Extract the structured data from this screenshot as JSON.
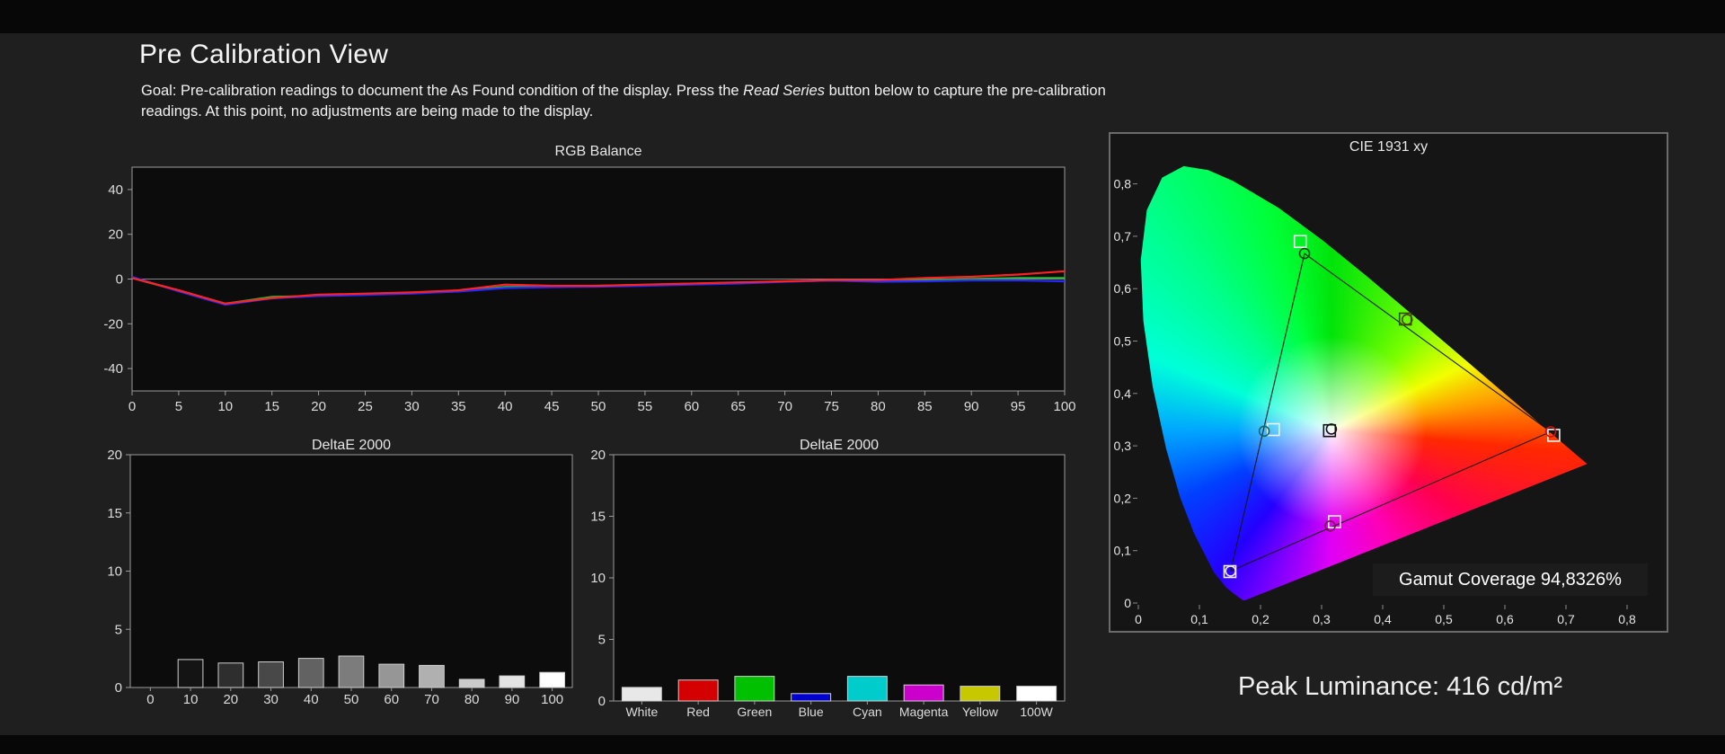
{
  "page": {
    "title": "Pre Calibration View",
    "goal": {
      "part1": "Goal: Pre-calibration readings to document the As Found condition of the display. Press the ",
      "italic": "Read Series",
      "part2": " button below to capture the pre-calibration readings. At this point, no adjustments are being made to the display."
    },
    "peak_luminance": "Peak Luminance: 416 cd/m²"
  },
  "chart_data": [
    {
      "id": "rgb_balance",
      "type": "line",
      "title": "RGB Balance",
      "xlabel": "",
      "ylabel": "",
      "ylim": [
        -50,
        50
      ],
      "y_ticks": [
        -40,
        -20,
        0,
        20,
        40
      ],
      "x_ticks": [
        0,
        5,
        10,
        15,
        20,
        25,
        30,
        35,
        40,
        45,
        50,
        55,
        60,
        65,
        70,
        75,
        80,
        85,
        90,
        95,
        100
      ],
      "x": [
        0,
        5,
        10,
        15,
        20,
        25,
        30,
        35,
        40,
        45,
        50,
        55,
        60,
        65,
        70,
        75,
        80,
        85,
        90,
        95,
        100
      ],
      "series": [
        {
          "name": "green",
          "color": "#2db82d",
          "values": [
            0.5,
            -5.2,
            -11.0,
            -8.0,
            -7.5,
            -7.0,
            -6.2,
            -5.5,
            -3.5,
            -3.5,
            -3.0,
            -2.6,
            -2.1,
            -1.6,
            -1.1,
            -0.6,
            -1.0,
            -0.5,
            0.0,
            0.5,
            0.5
          ]
        },
        {
          "name": "blue",
          "color": "#2828ff",
          "values": [
            1.0,
            -5.5,
            -11.5,
            -8.6,
            -7.6,
            -7.1,
            -6.5,
            -5.6,
            -4.0,
            -3.6,
            -3.4,
            -3.0,
            -2.5,
            -2.0,
            -1.2,
            -0.7,
            -1.2,
            -1.0,
            -0.6,
            -0.6,
            -1.0
          ]
        },
        {
          "name": "red",
          "color": "#ff2222",
          "values": [
            0.5,
            -5.0,
            -11.0,
            -8.5,
            -7.0,
            -6.5,
            -6.0,
            -5.0,
            -2.5,
            -3.0,
            -3.0,
            -2.5,
            -2.0,
            -1.5,
            -1.0,
            -0.5,
            -0.5,
            0.5,
            1.0,
            2.0,
            3.5
          ]
        }
      ]
    },
    {
      "id": "deltae_grayscale",
      "type": "bar",
      "title": "DeltaE 2000",
      "ylim": [
        0,
        20
      ],
      "y_ticks": [
        0,
        5,
        10,
        15,
        20
      ],
      "categories": [
        "0",
        "10",
        "20",
        "30",
        "40",
        "50",
        "60",
        "70",
        "80",
        "90",
        "100"
      ],
      "values": [
        0,
        2.4,
        2.1,
        2.2,
        2.5,
        2.7,
        2.0,
        1.9,
        0.7,
        1.0,
        1.3
      ],
      "bar_colors": [
        "#000000",
        "#141414",
        "#2e2e2e",
        "#484848",
        "#626262",
        "#7c7c7c",
        "#969696",
        "#b0b0b0",
        "#cacaca",
        "#e4e4e4",
        "#ffffff"
      ]
    },
    {
      "id": "deltae_colors",
      "type": "bar",
      "title": "DeltaE 2000",
      "ylim": [
        0,
        20
      ],
      "y_ticks": [
        0,
        5,
        10,
        15,
        20
      ],
      "categories": [
        "White",
        "Red",
        "Green",
        "Blue",
        "Cyan",
        "Magenta",
        "Yellow",
        "100W"
      ],
      "values": [
        1.1,
        1.7,
        2.0,
        0.6,
        2.0,
        1.3,
        1.2,
        1.2
      ],
      "bar_colors": [
        "#e8e8e8",
        "#d40000",
        "#00c000",
        "#0000d0",
        "#00cccc",
        "#cc00cc",
        "#c8c800",
        "#ffffff"
      ]
    },
    {
      "id": "cie",
      "type": "scatter",
      "title": "CIE 1931 xy",
      "coverage_label": "Gamut Coverage 94,8326%",
      "xlim": [
        0,
        0.85
      ],
      "ylim": [
        0,
        0.86
      ],
      "tick_values": [
        0,
        0.1,
        0.2,
        0.3,
        0.4,
        0.5,
        0.6,
        0.7,
        0.8
      ],
      "x_tick_labels": [
        "0",
        "0,1",
        "0,2",
        "0,3",
        "0,4",
        "0,5",
        "0,6",
        "0,7",
        "0,8"
      ],
      "y_tick_labels": [
        "0",
        "0,1",
        "0,2",
        "0,3",
        "0,4",
        "0,5",
        "0,6",
        "0,7",
        "0,8"
      ],
      "triangle": [
        [
          0.675,
          0.327
        ],
        [
          0.272,
          0.667
        ],
        [
          0.151,
          0.061
        ]
      ],
      "targets": [
        {
          "name": "white",
          "x": 0.313,
          "y": 0.329,
          "stroke": "#111111"
        },
        {
          "name": "red",
          "x": 0.68,
          "y": 0.32,
          "stroke": "#f2f2f2"
        },
        {
          "name": "green",
          "x": 0.265,
          "y": 0.69,
          "stroke": "#f2f2f2"
        },
        {
          "name": "blue",
          "x": 0.15,
          "y": 0.06,
          "stroke": "#f2f2f2"
        },
        {
          "name": "cyan",
          "x": 0.221,
          "y": 0.331,
          "stroke": "#f2f2f2"
        },
        {
          "name": "magenta",
          "x": 0.321,
          "y": 0.155,
          "stroke": "#f2f2f2"
        },
        {
          "name": "yellow",
          "x": 0.437,
          "y": 0.542,
          "stroke": "#404000"
        }
      ],
      "measured": [
        {
          "name": "white",
          "x": 0.316,
          "y": 0.332,
          "stroke": "#111111"
        },
        {
          "name": "red",
          "x": 0.675,
          "y": 0.327,
          "stroke": "#cc1111"
        },
        {
          "name": "green",
          "x": 0.272,
          "y": 0.667,
          "stroke": "#114411"
        },
        {
          "name": "blue",
          "x": 0.151,
          "y": 0.061,
          "stroke": "#e8e8e8"
        },
        {
          "name": "cyan",
          "x": 0.206,
          "y": 0.328,
          "stroke": "#0b6b6b"
        },
        {
          "name": "magenta",
          "x": 0.314,
          "y": 0.147,
          "stroke": "#7a1150"
        },
        {
          "name": "yellow",
          "x": 0.44,
          "y": 0.541,
          "stroke": "#454500"
        }
      ],
      "locus": [
        [
          0.1741,
          0.005
        ],
        [
          0.1714,
          0.0051
        ],
        [
          0.1644,
          0.0109
        ],
        [
          0.1566,
          0.0177
        ],
        [
          0.144,
          0.0297
        ],
        [
          0.1241,
          0.0578
        ],
        [
          0.0913,
          0.1327
        ],
        [
          0.0687,
          0.2007
        ],
        [
          0.0454,
          0.295
        ],
        [
          0.0235,
          0.4127
        ],
        [
          0.0082,
          0.5384
        ],
        [
          0.0039,
          0.6548
        ],
        [
          0.0139,
          0.7502
        ],
        [
          0.0389,
          0.812
        ],
        [
          0.0743,
          0.8338
        ],
        [
          0.1142,
          0.8262
        ],
        [
          0.1547,
          0.8059
        ],
        [
          0.2296,
          0.7543
        ],
        [
          0.3016,
          0.6923
        ],
        [
          0.3731,
          0.6245
        ],
        [
          0.4441,
          0.5547
        ],
        [
          0.5125,
          0.4866
        ],
        [
          0.5752,
          0.4242
        ],
        [
          0.627,
          0.3725
        ],
        [
          0.6658,
          0.334
        ],
        [
          0.6915,
          0.3083
        ],
        [
          0.7079,
          0.292
        ],
        [
          0.719,
          0.2809
        ],
        [
          0.726,
          0.274
        ],
        [
          0.7347,
          0.2653
        ]
      ]
    }
  ]
}
